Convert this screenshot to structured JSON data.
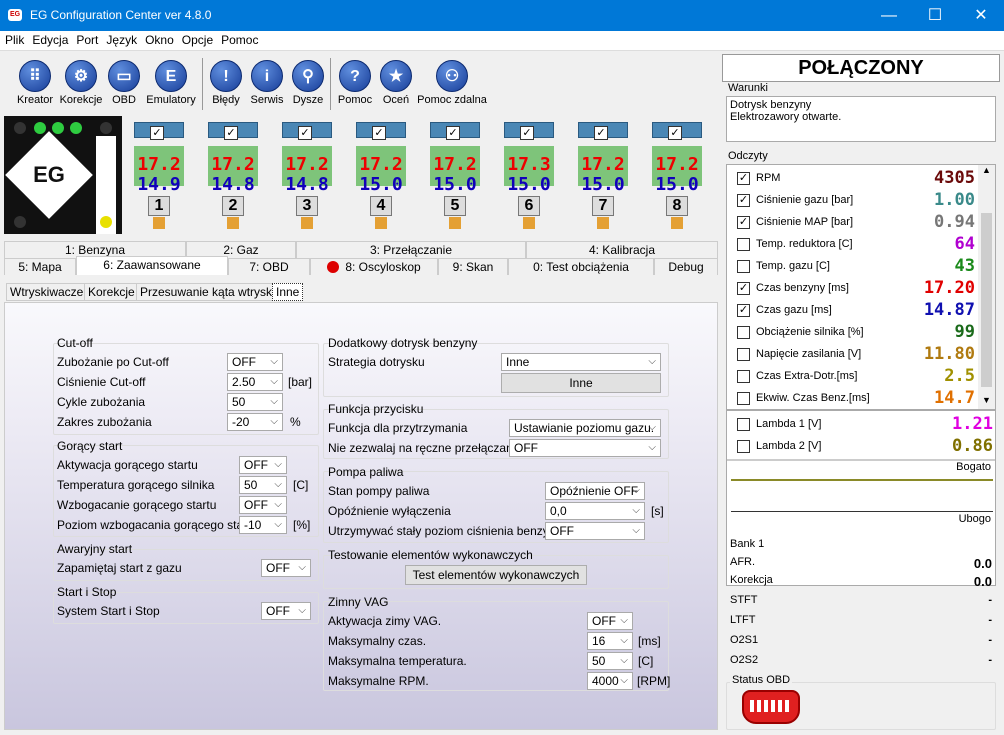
{
  "window": {
    "title": "EG Configuration Center ver 4.8.0",
    "app_icon_label": "EG"
  },
  "menu": [
    "Plik",
    "Edycja",
    "Port",
    "Język",
    "Okno",
    "Opcje",
    "Pomoc"
  ],
  "toolbar": [
    {
      "label": "Kreator",
      "icon": "keypad-icon",
      "glyph": "⠿"
    },
    {
      "label": "Korekcje",
      "icon": "gear-icon",
      "glyph": "⚙"
    },
    {
      "label": "OBD",
      "icon": "obd-plug-icon",
      "glyph": "▭"
    },
    {
      "label": "Emulatory",
      "icon": "emulator-icon",
      "glyph": "E"
    },
    {
      "label": "Błędy",
      "icon": "exclamation-icon",
      "glyph": "!"
    },
    {
      "label": "Serwis",
      "icon": "info-icon",
      "glyph": "i"
    },
    {
      "label": "Dysze",
      "icon": "injector-icon",
      "glyph": "⚲"
    },
    {
      "label": "Pomoc",
      "icon": "question-icon",
      "glyph": "?"
    },
    {
      "label": "Oceń",
      "icon": "star-icon",
      "glyph": "★"
    },
    {
      "label": "Pomoc zdalna",
      "icon": "remote-help-icon",
      "glyph": "⚇"
    }
  ],
  "logo_text": "EG",
  "injectors": [
    {
      "num": "1",
      "petrol": "17.2",
      "gas": "14.9"
    },
    {
      "num": "2",
      "petrol": "17.2",
      "gas": "14.8"
    },
    {
      "num": "3",
      "petrol": "17.2",
      "gas": "14.8"
    },
    {
      "num": "4",
      "petrol": "17.2",
      "gas": "15.0"
    },
    {
      "num": "5",
      "petrol": "17.2",
      "gas": "15.0"
    },
    {
      "num": "6",
      "petrol": "17.3",
      "gas": "15.0"
    },
    {
      "num": "7",
      "petrol": "17.2",
      "gas": "15.0"
    },
    {
      "num": "8",
      "petrol": "17.2",
      "gas": "15.0"
    }
  ],
  "tabs_row1": [
    "1: Benzyna",
    "2: Gaz",
    "3: Przełączanie",
    "4: Kalibracja"
  ],
  "tabs_row2": [
    "5: Mapa",
    "6: Zaawansowane",
    "7: OBD",
    "8: Oscyloskop",
    "9: Skan",
    "0: Test obciążenia",
    "Debug"
  ],
  "subtabs": [
    "Wtryskiwacze",
    "Korekcje",
    "Przesuwanie kąta wtrysku",
    "Inne"
  ],
  "cutoff": {
    "title": "Cut-off",
    "rows": [
      {
        "label": "Zubożanie po Cut-off",
        "value": "OFF",
        "unit": ""
      },
      {
        "label": "Ciśnienie Cut-off",
        "value": "2.50",
        "unit": "[bar]"
      },
      {
        "label": "Cykle zubożania",
        "value": "50",
        "unit": ""
      },
      {
        "label": "Zakres zubożania",
        "value": "-20",
        "unit": "%"
      }
    ]
  },
  "hotstart": {
    "title": "Gorący start",
    "rows": [
      {
        "label": "Aktywacja gorącego startu",
        "value": "OFF",
        "unit": ""
      },
      {
        "label": "Temperatura gorącego silnika",
        "value": "50",
        "unit": "[C]"
      },
      {
        "label": "Wzbogacanie gorącego startu",
        "value": "OFF",
        "unit": ""
      },
      {
        "label": "Poziom wzbogacania gorącego startu",
        "value": "-10",
        "unit": "[%]"
      }
    ]
  },
  "emergency": {
    "title": "Awaryjny start",
    "label": "Zapamiętaj start z gazu",
    "value": "OFF"
  },
  "startstop": {
    "title": "Start i Stop",
    "label": "System Start i Stop",
    "value": "OFF"
  },
  "extra_petrol": {
    "title": "Dodatkowy dotrysk benzyny",
    "label": "Strategia dotrysku",
    "value": "Inne",
    "button": "Inne"
  },
  "button_func": {
    "title": "Funkcja przycisku",
    "rows": [
      {
        "label": "Funkcja dla przytrzymania",
        "value": "Ustawianie poziomu gazu."
      },
      {
        "label": "Nie zezwalaj na ręczne przełączanie",
        "value": "OFF"
      }
    ]
  },
  "fuel_pump": {
    "title": "Pompa paliwa",
    "rows": [
      {
        "label": "Stan pompy paliwa",
        "value": "Opóźnienie OFF",
        "unit": ""
      },
      {
        "label": "Opóźnienie wyłączenia",
        "value": "0,0",
        "unit": "[s]"
      },
      {
        "label": "Utrzymywać stały poziom ciśnienia benzyny.",
        "value": "OFF",
        "unit": ""
      }
    ]
  },
  "actuators": {
    "title": "Testowanie elementów wykonawczych",
    "button": "Test elementów wykonawczych"
  },
  "winter_vag": {
    "title": "Zimny VAG",
    "rows": [
      {
        "label": "Aktywacja zimy VAG.",
        "value": "OFF",
        "unit": ""
      },
      {
        "label": "Maksymalny czas.",
        "value": "16",
        "unit": "[ms]"
      },
      {
        "label": "Maksymalna temperatura.",
        "value": "50",
        "unit": "[C]"
      },
      {
        "label": "Maksymalne RPM.",
        "value": "4000",
        "unit": "[RPM]"
      }
    ]
  },
  "status": "POŁĄCZONY",
  "conditions": {
    "title": "Warunki",
    "lines": [
      "Dotrysk benzyny",
      "Elektrozawory otwarte."
    ]
  },
  "readings": {
    "title": "Odczyty",
    "items": [
      {
        "label": "RPM",
        "value": "4305",
        "checked": true,
        "color": "#6b0a0a"
      },
      {
        "label": "Ciśnienie gazu [bar]",
        "value": "1.00",
        "checked": true,
        "color": "#3a8a8a"
      },
      {
        "label": "Ciśnienie MAP [bar]",
        "value": "0.94",
        "checked": true,
        "color": "#777777"
      },
      {
        "label": "Temp. reduktora [C]",
        "value": "64",
        "checked": false,
        "color": "#b000d0"
      },
      {
        "label": "Temp. gazu [C]",
        "value": "43",
        "checked": false,
        "color": "#1a8a1a"
      },
      {
        "label": "Czas benzyny [ms]",
        "value": "17.20",
        "checked": true,
        "color": "#e00000"
      },
      {
        "label": "Czas gazu [ms]",
        "value": "14.87",
        "checked": true,
        "color": "#1010b0"
      },
      {
        "label": "Obciążenie silnika [%]",
        "value": "99",
        "checked": false,
        "color": "#1a6a1a"
      },
      {
        "label": "Napięcie zasilania [V]",
        "value": "11.80",
        "checked": false,
        "color": "#b07a10"
      },
      {
        "label": "Czas Extra-Dotr.[ms]",
        "value": "2.5",
        "checked": false,
        "color": "#a09000"
      },
      {
        "label": "Ekwiw. Czas Benz.[ms]",
        "value": "14.7",
        "checked": false,
        "color": "#e07000"
      }
    ]
  },
  "lambda": [
    {
      "label": "Lambda 1 [V]",
      "value": "1.21",
      "checked": false,
      "color": "#e000e0"
    },
    {
      "label": "Lambda 2 [V]",
      "value": "0.86",
      "checked": false,
      "color": "#807000"
    }
  ],
  "mixture": {
    "rich": "Bogato",
    "lean": "Ubogo"
  },
  "bank": {
    "title": "Bank 1",
    "rows": [
      {
        "label": "AFR.",
        "value": "0.0"
      },
      {
        "label": "Korekcja",
        "value": "0.0"
      },
      {
        "label": "STFT",
        "value": "-"
      },
      {
        "label": "LTFT",
        "value": "-"
      },
      {
        "label": "O2S1",
        "value": "-"
      },
      {
        "label": "O2S2",
        "value": "-"
      }
    ]
  },
  "obd_status": {
    "title": "Status OBD"
  }
}
